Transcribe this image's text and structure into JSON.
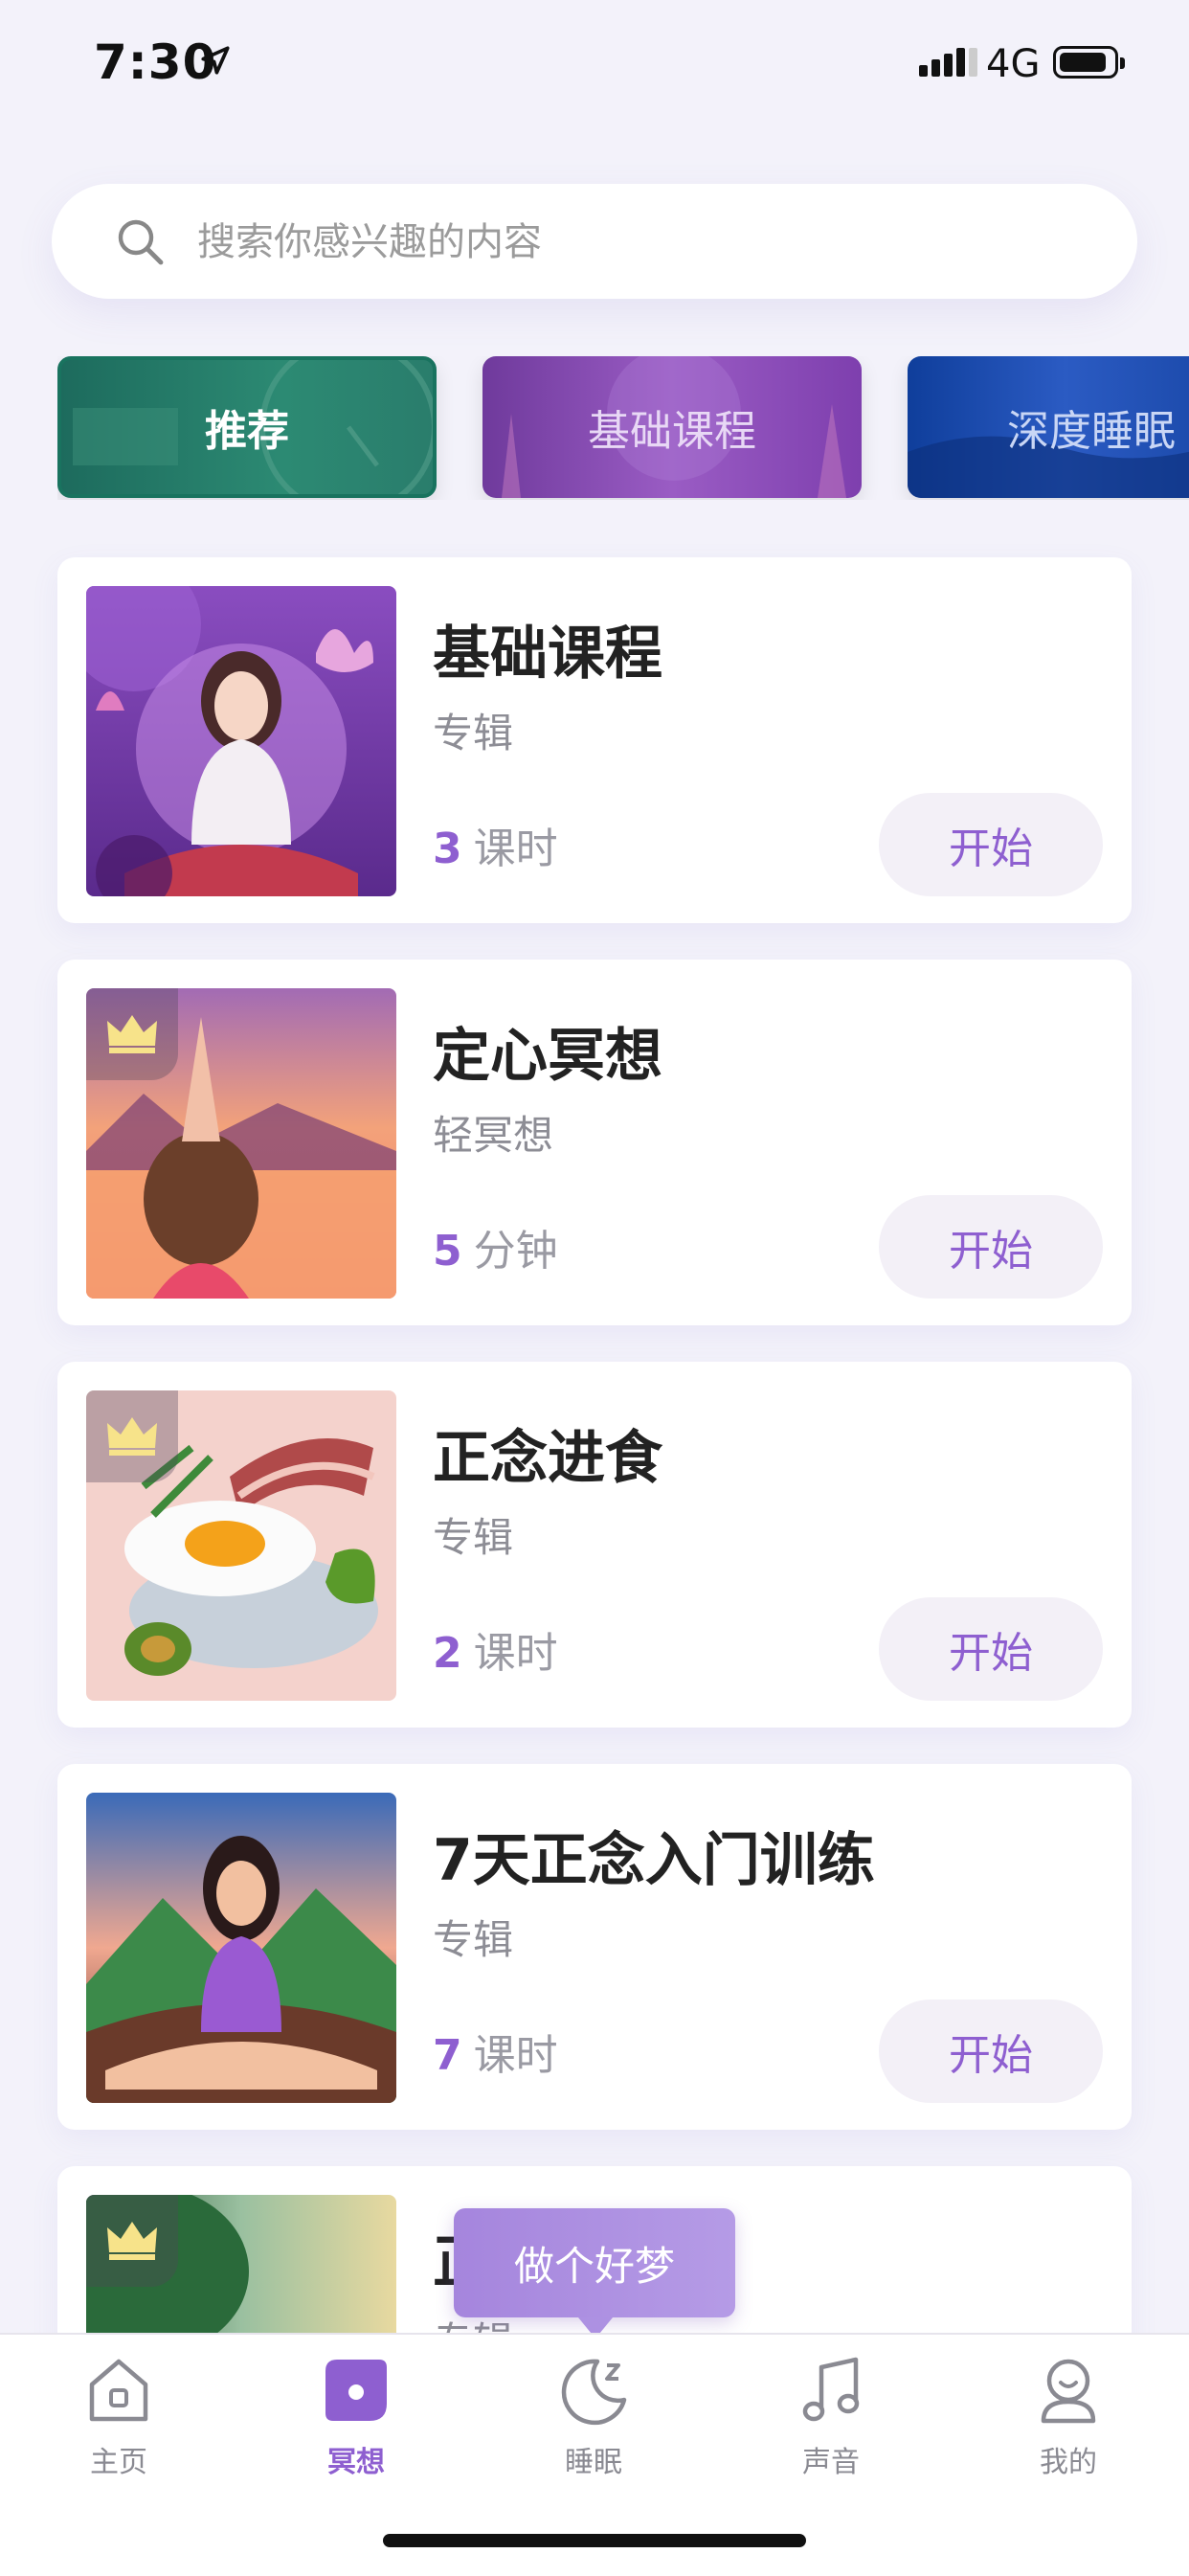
{
  "status_bar": {
    "time": "7:30",
    "network": "4G"
  },
  "search": {
    "placeholder": "搜索你感兴趣的内容"
  },
  "categories": [
    {
      "label": "推荐",
      "selected": true
    },
    {
      "label": "基础课程",
      "selected": false
    },
    {
      "label": "深度睡眠",
      "selected": false
    }
  ],
  "cards": [
    {
      "title": "基础课程",
      "subtitle": "专辑",
      "count": "3",
      "unit": "课时",
      "button": "开始",
      "premium": false,
      "thumb": "meditation-lotus-illustration"
    },
    {
      "title": "定心冥想",
      "subtitle": "轻冥想",
      "count": "5",
      "unit": "分钟",
      "button": "开始",
      "premium": true,
      "thumb": "sunset-lake-illustration"
    },
    {
      "title": "正念进食",
      "subtitle": "专辑",
      "count": "2",
      "unit": "课时",
      "button": "开始",
      "premium": true,
      "thumb": "breakfast-food-illustration"
    },
    {
      "title": "7天正念入门训练",
      "subtitle": "专辑",
      "count": "7",
      "unit": "课时",
      "button": "开始",
      "premium": false,
      "thumb": "mountain-meditation-illustration"
    },
    {
      "title": "正",
      "subtitle": "专辑",
      "premium": true,
      "thumb": "nature-illustration"
    }
  ],
  "tooltip": {
    "text": "做个好梦"
  },
  "tabs": [
    {
      "label": "主页",
      "icon": "home-icon",
      "active": false
    },
    {
      "label": "冥想",
      "icon": "meditation-icon",
      "active": true
    },
    {
      "label": "睡眠",
      "icon": "moon-icon",
      "active": false
    },
    {
      "label": "声音",
      "icon": "music-note-icon",
      "active": false
    },
    {
      "label": "我的",
      "icon": "profile-icon",
      "active": false
    }
  ],
  "colors": {
    "accent": "#8e5fd0",
    "background": "#f3f2fa"
  }
}
